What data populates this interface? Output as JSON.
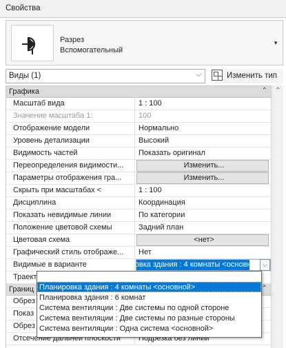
{
  "window": {
    "title": "Свойства"
  },
  "type_selector": {
    "line1": "Разрез",
    "line2": "Вспомогательный",
    "icon": "section-view-icon"
  },
  "filter": {
    "value": "Виды (1)",
    "edit_type_label": "Изменить тип"
  },
  "sections": [
    {
      "label": "Графика",
      "rows": [
        {
          "name": "Масштаб вида",
          "value": "1 : 100",
          "kind": "text"
        },
        {
          "name": "Значение масштаба    1:",
          "value": "100",
          "kind": "readonly"
        },
        {
          "name": "Отображение модели",
          "value": "Нормально",
          "kind": "text"
        },
        {
          "name": "Уровень детализации",
          "value": "Высокий",
          "kind": "text"
        },
        {
          "name": "Видимость частей",
          "value": "Показать оригинал",
          "kind": "text"
        },
        {
          "name": "Переопределения видимости...",
          "value": "Изменить...",
          "kind": "button"
        },
        {
          "name": "Параметры отображения гра...",
          "value": "Изменить...",
          "kind": "button"
        },
        {
          "name": "Скрыть при масштабах <",
          "value": "1 : 100",
          "kind": "text"
        },
        {
          "name": "Дисциплина",
          "value": "Координация",
          "kind": "text"
        },
        {
          "name": "Показать невидимые линии",
          "value": "По категории",
          "kind": "text"
        },
        {
          "name": "Положение цветовой схемы",
          "value": "Задний план",
          "kind": "text"
        },
        {
          "name": "Цветовая схема",
          "value": "<нет>",
          "kind": "button"
        },
        {
          "name": "Графический стиль отображе...",
          "value": "Нет",
          "kind": "text"
        },
        {
          "name": "Видимые в варианте",
          "value": "Планировка здания : 4 комнаты  <основной>",
          "kind": "active"
        },
        {
          "name": "Траектсве",
          "value": "",
          "kind": "text"
        }
      ]
    },
    {
      "label": "Границ",
      "rows": [
        {
          "name": "Обрез",
          "value": "",
          "kind": "text"
        },
        {
          "name": "Показ",
          "value": "",
          "kind": "text"
        },
        {
          "name": "Обрез",
          "value": "",
          "kind": "text"
        },
        {
          "name": "Отсечение дальней плоскости",
          "value": "Подрезка без линии",
          "kind": "text"
        }
      ]
    }
  ],
  "dropdown": {
    "top_text": "",
    "options": [
      "Планировка здания : 4 комнаты  <основной>",
      "Планировка здания : 6 комнат",
      "Система вентиляции : Две системы по одной стороне",
      "Система вентиляции : Две системы по разные стороны",
      "Система вентиляции : Одна система  <основной>"
    ],
    "selected_index": 0
  },
  "colors": {
    "selection": "#0078d7",
    "section_header": "#dcdcdc"
  }
}
